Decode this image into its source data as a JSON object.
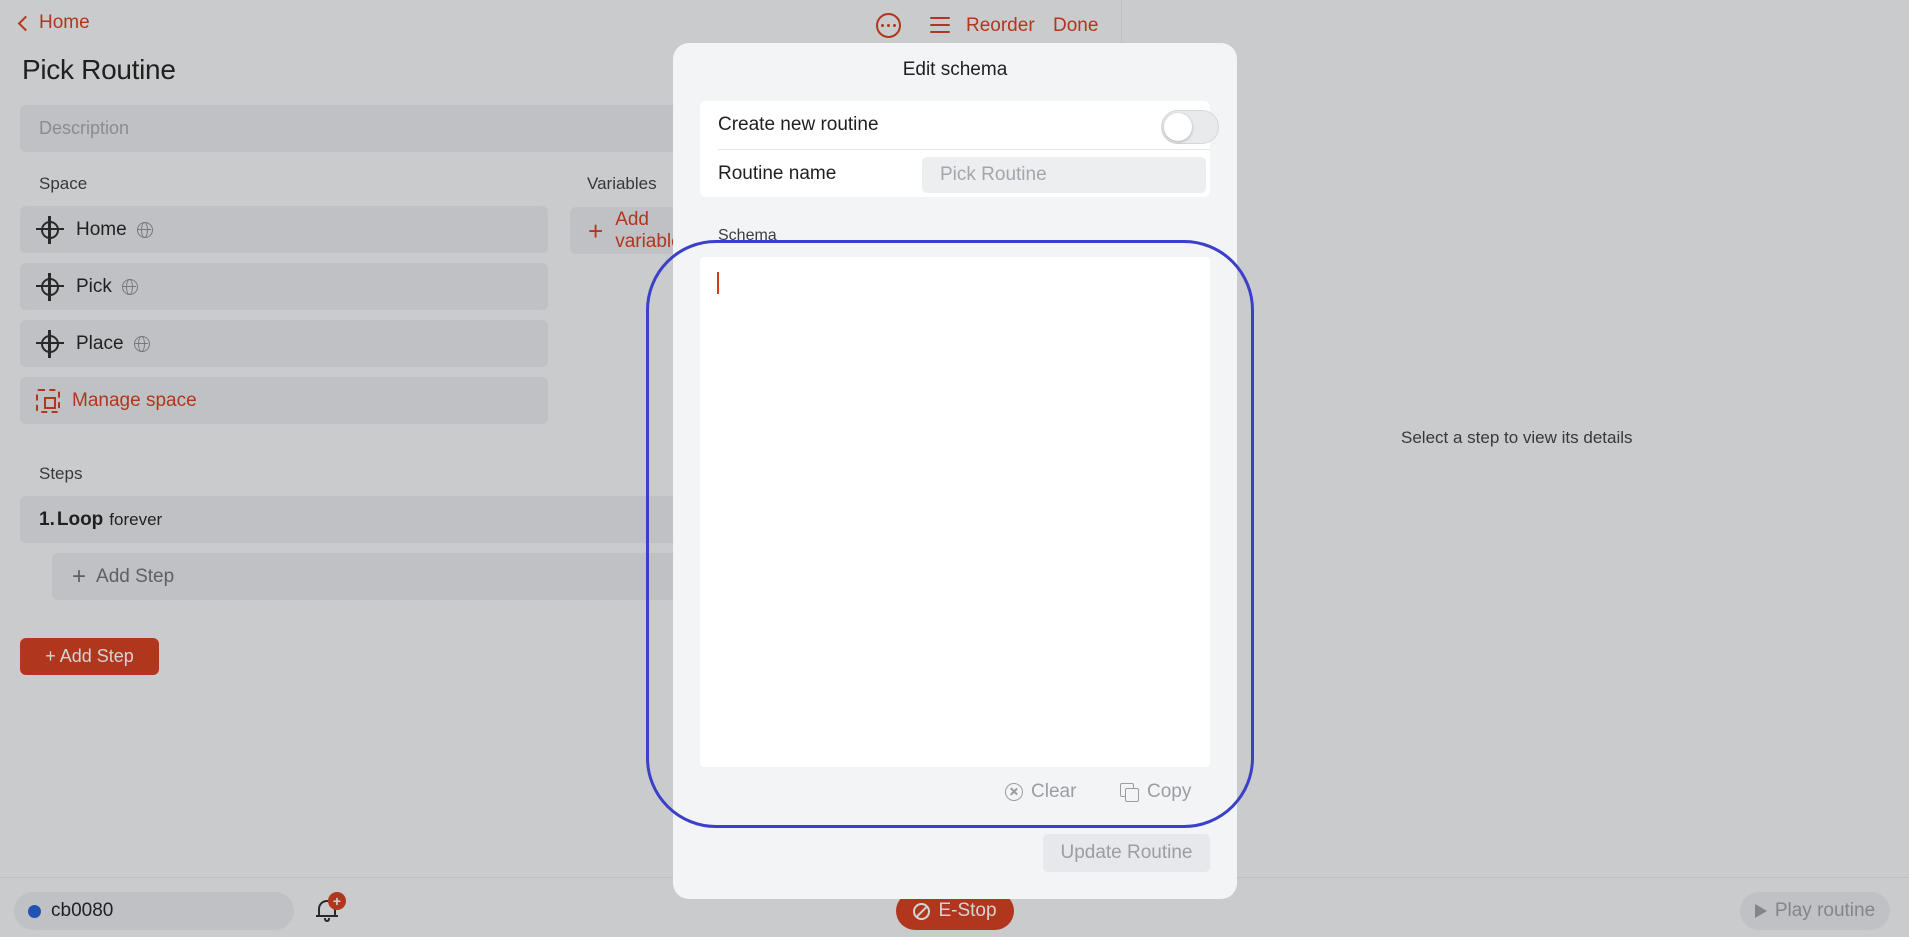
{
  "header": {
    "back_label": "Home",
    "title": "Pick Routine",
    "reorder_label": "Reorder",
    "done_label": "Done"
  },
  "description": {
    "placeholder": "Description"
  },
  "space": {
    "label": "Space",
    "items": [
      {
        "label": "Home"
      },
      {
        "label": "Pick"
      },
      {
        "label": "Place"
      }
    ],
    "manage_label": "Manage space"
  },
  "variables": {
    "label": "Variables",
    "add_label": "Add variable"
  },
  "steps": {
    "label": "Steps",
    "items": [
      {
        "number": "1.",
        "name": "Loop",
        "detail": "forever"
      }
    ],
    "inner_add_label": "Add Step",
    "add_button_label": "+ Add Step"
  },
  "detail_panel": {
    "empty_text": "Select a step to view its details"
  },
  "bottom_bar": {
    "device_name": "cb0080",
    "notification_badge": "+",
    "estop_label": "E-Stop",
    "play_label": "Play routine"
  },
  "modal": {
    "title": "Edit schema",
    "create_new_label": "Create new routine",
    "create_new_on": false,
    "routine_name_label": "Routine name",
    "routine_name_placeholder": "Pick Routine",
    "schema_label": "Schema",
    "schema_value": "",
    "clear_label": "Clear",
    "copy_label": "Copy",
    "update_label": "Update Routine"
  },
  "colors": {
    "accent": "#d23a1c",
    "status_dot": "#1f5fd6",
    "highlight": "#3a40c9"
  }
}
